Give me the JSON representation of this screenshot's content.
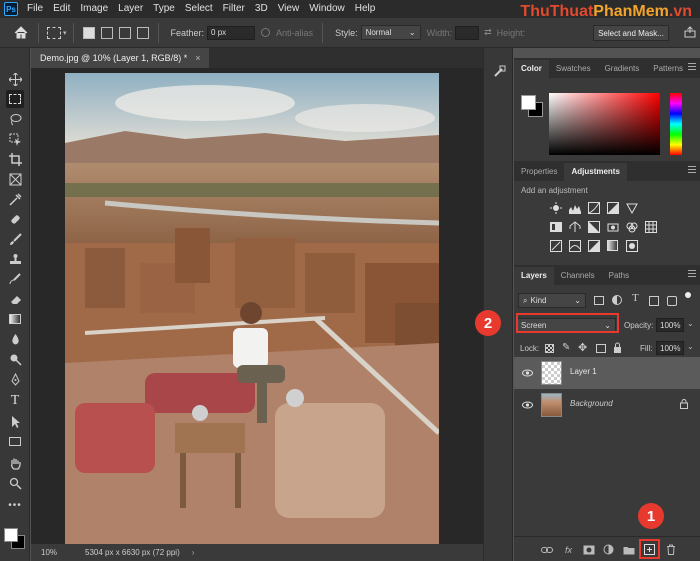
{
  "app": {
    "logo": "Ps"
  },
  "menu": [
    "File",
    "Edit",
    "Image",
    "Layer",
    "Type",
    "Select",
    "Filter",
    "3D",
    "View",
    "Window",
    "Help"
  ],
  "watermark": {
    "part1": "ThuThuat",
    "part2": "PhanMem",
    "part3": ".vn"
  },
  "options": {
    "feather_label": "Feather:",
    "feather_value": "0 px",
    "antialias_label": "Anti-alias",
    "style_label": "Style:",
    "style_value": "Normal",
    "width_label": "Width:",
    "height_label": "Height:",
    "select_mask_label": "Select and Mask..."
  },
  "document": {
    "tab_title": "Demo.jpg @ 10% (Layer 1, RGB/8) *",
    "tab_close": "×",
    "zoom": "10%",
    "info": "5304 px x 6630 px (72 ppi)",
    "status_arrow": "›"
  },
  "color_panel": {
    "tabs": [
      "Color",
      "Swatches",
      "Gradients",
      "Patterns"
    ],
    "foreground": "#ffffff",
    "background": "#000000"
  },
  "adjustments_panel": {
    "tabs": [
      "Properties",
      "Adjustments"
    ],
    "title": "Add an adjustment"
  },
  "layers_panel": {
    "tabs": [
      "Layers",
      "Channels",
      "Paths"
    ],
    "filter_kind": "Kind",
    "blend_mode": "Screen",
    "opacity_label": "Opacity:",
    "opacity_value": "100%",
    "lock_label": "Lock:",
    "fill_label": "Fill:",
    "fill_value": "100%",
    "layers": [
      {
        "name": "Layer 1",
        "selected": true
      },
      {
        "name": "Background",
        "selected": false,
        "locked": true
      }
    ],
    "footer_fx": "fx"
  },
  "annotations": {
    "badge1": "1",
    "badge2": "2",
    "color": "#e8392f"
  }
}
